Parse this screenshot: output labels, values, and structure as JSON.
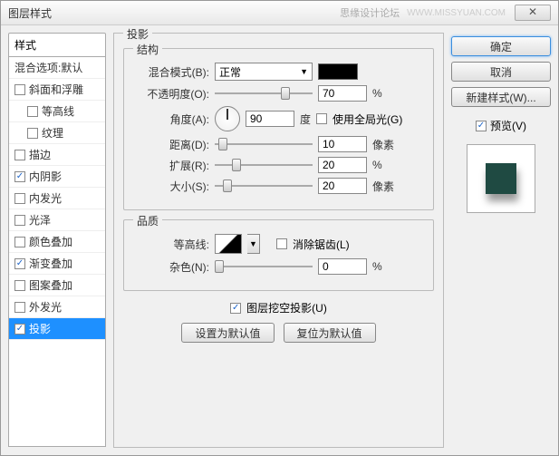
{
  "titlebar": {
    "title": "图层样式",
    "watermark": "思缘设计论坛",
    "url": "WWW.MISSYUAN.COM",
    "close": "✕"
  },
  "left": {
    "header": "样式",
    "blend_options": "混合选项:默认",
    "items": [
      {
        "label": "斜面和浮雕",
        "checked": false
      },
      {
        "label": "等高线",
        "checked": false,
        "sub": true
      },
      {
        "label": "纹理",
        "checked": false,
        "sub": true
      },
      {
        "label": "描边",
        "checked": false
      },
      {
        "label": "内阴影",
        "checked": true
      },
      {
        "label": "内发光",
        "checked": false
      },
      {
        "label": "光泽",
        "checked": false
      },
      {
        "label": "颜色叠加",
        "checked": false
      },
      {
        "label": "渐变叠加",
        "checked": true
      },
      {
        "label": "图案叠加",
        "checked": false
      },
      {
        "label": "外发光",
        "checked": false
      },
      {
        "label": "投影",
        "checked": true,
        "selected": true
      }
    ]
  },
  "panel": {
    "title": "投影",
    "structure": {
      "legend": "结构",
      "blend_mode_label": "混合模式(B):",
      "blend_mode_value": "正常",
      "color": "#000000",
      "opacity_label": "不透明度(O):",
      "opacity_value": "70",
      "opacity_unit": "%",
      "angle_label": "角度(A):",
      "angle_value": "90",
      "angle_unit": "度",
      "global_light_label": "使用全局光(G)",
      "global_light_checked": false,
      "distance_label": "距离(D):",
      "distance_value": "10",
      "distance_unit": "像素",
      "spread_label": "扩展(R):",
      "spread_value": "20",
      "spread_unit": "%",
      "size_label": "大小(S):",
      "size_value": "20",
      "size_unit": "像素"
    },
    "quality": {
      "legend": "品质",
      "contour_label": "等高线:",
      "antialias_label": "消除锯齿(L)",
      "antialias_checked": false,
      "noise_label": "杂色(N):",
      "noise_value": "0",
      "noise_unit": "%"
    },
    "knockout_label": "图层挖空投影(U)",
    "knockout_checked": true,
    "make_default": "设置为默认值",
    "reset_default": "复位为默认值"
  },
  "right": {
    "ok": "确定",
    "cancel": "取消",
    "new_style": "新建样式(W)...",
    "preview_label": "预览(V)",
    "preview_checked": true
  }
}
